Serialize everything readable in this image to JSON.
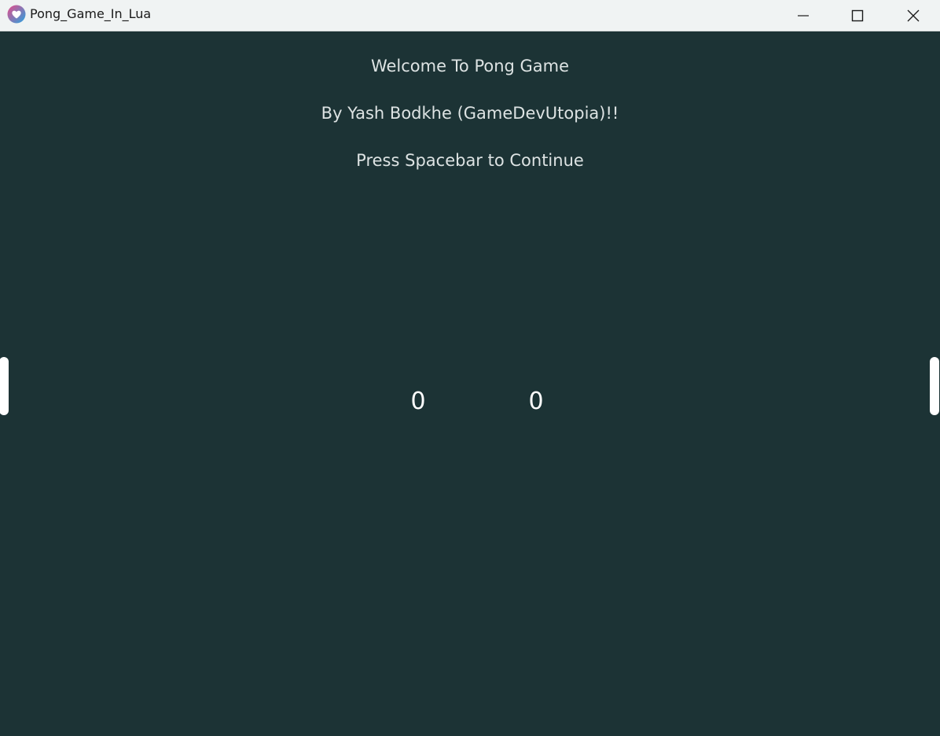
{
  "window": {
    "title": "Pong_Game_In_Lua",
    "icon": "love2d-heart-icon",
    "controls": [
      "minimize-icon",
      "maximize-icon",
      "close-icon"
    ]
  },
  "game": {
    "welcome_text": "Welcome To Pong Game",
    "author_text": "By Yash Bodkhe (GameDevUtopia)!!",
    "prompt_text": "Press Spacebar to Continue",
    "score": {
      "player1": "0",
      "player2": "0"
    },
    "colors": {
      "background": "#1c3335",
      "text": "#dde3e3",
      "paddle": "#ffffff"
    }
  }
}
